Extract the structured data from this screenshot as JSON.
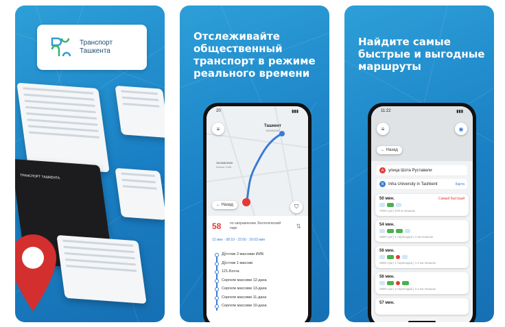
{
  "panel1": {
    "logo_line1": "Транспорт",
    "logo_line2": "Ташкента",
    "splash_title": "ТРАНСПОРТ ТАШКЕНТА"
  },
  "panel2": {
    "headline": "Отслеживайте общественный транспорт в режиме реального времени",
    "status_time": "20",
    "map_label_city": "Ташкент",
    "map_label_city_en": "TASHKENT",
    "map_label_1": "Зоомагазин",
    "map_label_2": "Катыш Сайт",
    "back_label": "← Назад",
    "route_number": "58",
    "route_direction": "по направлению Зоологический парк",
    "route_meta": "12 мин · 08:10 - 22:00 · 20:03 мин",
    "stops": [
      "Дўстлик 2-массиви ИИБ",
      "Дўстлик 1-массив",
      "121-Богча",
      "Сергели массиви 12-даха",
      "Сергели массиви 13-даха",
      "Сергели массиви 11-даха",
      "Сергели массиви 10-даха"
    ]
  },
  "panel3": {
    "headline": "Найдите самые быстрые и выгодные маршруты",
    "status_time": "11:22",
    "back_label": "← Назад",
    "from": "улица Шота Руставели",
    "to": "Inha University in Tashkent",
    "swap_label": "Карта",
    "options": [
      {
        "time": "50 мин.",
        "tag": "Самый быстрый",
        "sub": "7000 сум | 876 м пешком"
      },
      {
        "time": "54 мин.",
        "tag": "",
        "sub": "2800 сум | 1 пересадка | 1 км пешком"
      },
      {
        "time": "56 мин.",
        "tag": "",
        "sub": "2800 сум | 1 пересадка | 1.2 км пешком"
      },
      {
        "time": "56 мин.",
        "tag": "",
        "sub": "2800 сум | 2 пересадки | 2.4 км пешком"
      },
      {
        "time": "57 мин.",
        "tag": "",
        "sub": ""
      }
    ]
  },
  "colors": {
    "brand_blue": "#1a7fc4",
    "accent_red": "#e53935",
    "route_blue": "#3a7bd5"
  }
}
